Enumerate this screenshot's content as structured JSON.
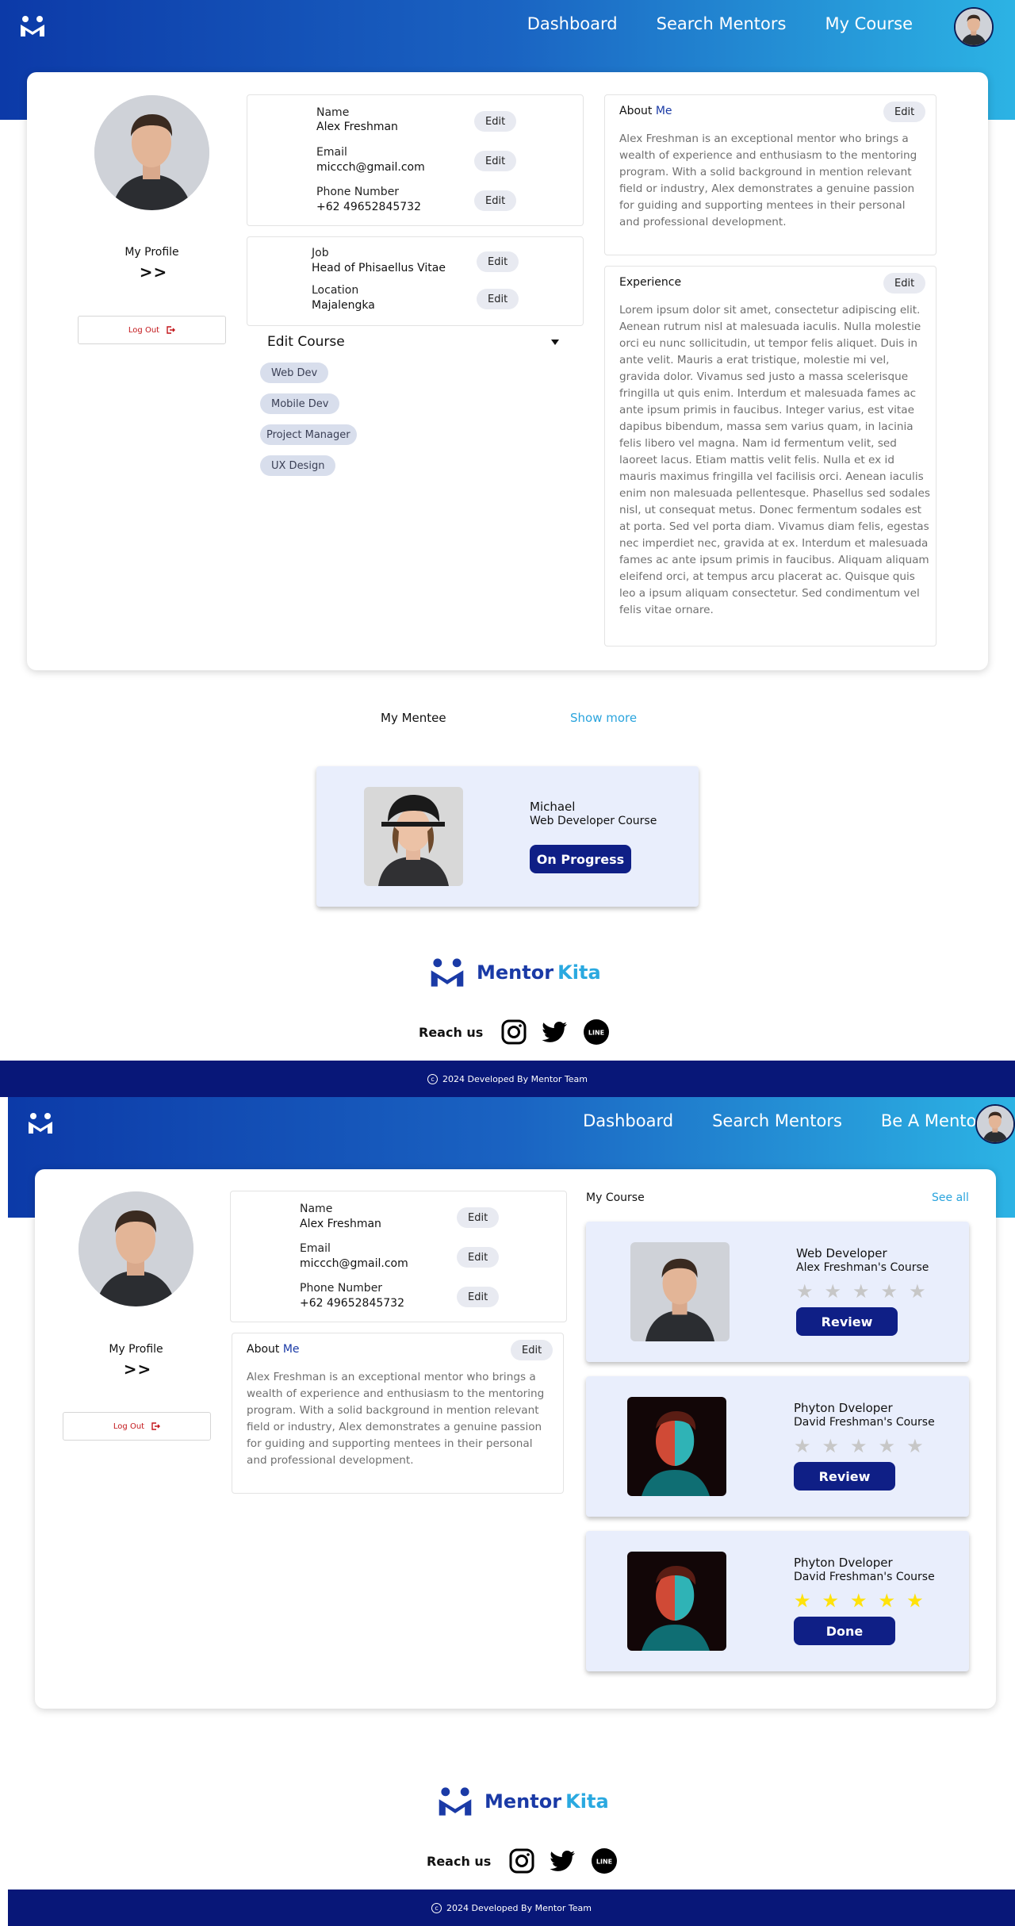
{
  "colors": {
    "primary": "#0f1f86",
    "accent": "#2aa4dd",
    "danger": "#c3171b",
    "star_on": "#ffe20a",
    "star_off": "#c7c7c7"
  },
  "screen1": {
    "nav": {
      "links": [
        "Dashboard",
        "Search Mentors",
        "My Course"
      ]
    },
    "sidebar": {
      "profile_label": "My Profile",
      "chevrons": "> >",
      "logout_label": "Log Out"
    },
    "contact": [
      {
        "label": "Name",
        "value": "Alex Freshman",
        "edit": "Edit"
      },
      {
        "label": "Email",
        "value": "miccch@gmail.com",
        "edit": "Edit"
      },
      {
        "label": "Phone Number",
        "value": "+62 49652845732",
        "edit": "Edit"
      }
    ],
    "work": [
      {
        "label": "Job",
        "value": "Head of Phisaellus Vitae",
        "edit": "Edit"
      },
      {
        "label": "Location",
        "value": "Majalengka",
        "edit": "Edit"
      }
    ],
    "edit_course": {
      "label": "Edit Course",
      "tags": [
        "Web Dev",
        "Mobile Dev",
        "Project Manager",
        "UX Design"
      ]
    },
    "about": {
      "title_prefix": "About ",
      "title_accent": "Me",
      "edit": "Edit",
      "text": "Alex Freshman is an exceptional mentor who brings a wealth of experience  and enthusiasm to the mentoring program. With a solid background in mention relevant field or industry, Alex demonstrates a genuine  passion for guiding and supporting mentees in their personal and  professional development."
    },
    "experience": {
      "title": "Experience",
      "edit": "Edit",
      "text": " Lorem ipsum dolor sit amet, consectetur adipiscing elit. Aenean rutrum  nisl at malesuada iaculis. Nulla molestie orci eu nunc sollicitudin, ut  tempor felis aliquet. Duis in ante velit. Mauris a erat tristique, molestie mi vel, gravida dolor. Vivamus sed justo a massa scelerisque  fringilla ut quis enim. Interdum et malesuada fames ac ante ipsum primis  in faucibus. Integer varius, est vitae dapibus bibendum, massa sem  varius quam, in lacinia felis libero vel magna.  Nam id fermentum velit, sed laoreet lacus. Etiam mattis velit felis.  Nulla et ex id mauris maximus fringilla vel facilisis orci. Aenean  iaculis enim non malesuada pellentesque. Phasellus sed sodales nisl, ut  consequat metus. Donec fermentum sodales est at porta. Sed vel porta  diam. Vivamus diam felis, egestas nec imperdiet nec, gravida at ex.  Interdum et malesuada fames ac ante ipsum primis in faucibus. Aliquam  aliquam eleifend orci, at tempus arcu placerat ac. Quisque quis leo a  ipsum aliquam consectetur. Sed condimentum vel felis vitae ornare."
    },
    "mentee": {
      "title": "My Mentee",
      "show_more": "Show more",
      "card": {
        "name": "Michael",
        "course": "Web Developer Course",
        "status": "On Progress"
      }
    },
    "footer": {
      "brand_1": "Mentor",
      "brand_2": "Kita",
      "reach": "Reach us",
      "copyright_symbol": "c",
      "copyright": "2024 Developed By Mentor Team"
    }
  },
  "screen2": {
    "nav": {
      "links": [
        "Dashboard",
        "Search Mentors",
        "Be A Mentor"
      ]
    },
    "sidebar": {
      "profile_label": "My Profile",
      "chevrons": "> >",
      "logout_label": "Log Out"
    },
    "contact": [
      {
        "label": "Name",
        "value": "Alex Freshman",
        "edit": "Edit"
      },
      {
        "label": "Email",
        "value": "miccch@gmail.com",
        "edit": "Edit"
      },
      {
        "label": "Phone Number",
        "value": "+62 49652845732",
        "edit": "Edit"
      }
    ],
    "about": {
      "title_prefix": "About ",
      "title_accent": "Me",
      "edit": "Edit",
      "text": "Alex Freshman is an exceptional mentor who brings a wealth of experience  and enthusiasm to the mentoring program. With a solid background in mention relevant field or industry, Alex demonstrates a genuine  passion for guiding and supporting mentees in their personal and  professional development."
    },
    "my_course": {
      "title": "My Course",
      "see_all": "See all",
      "items": [
        {
          "title": "Web Developer",
          "subtitle": "Alex Freshman's Course",
          "stars": 0,
          "action": "Review"
        },
        {
          "title": "Phyton Dveloper",
          "subtitle": "David Freshman's Course",
          "stars": 0,
          "action": "Review"
        },
        {
          "title": "Phyton Dveloper",
          "subtitle": "David Freshman's Course",
          "stars": 5,
          "action": "Done"
        }
      ]
    },
    "footer": {
      "brand_1": "Mentor",
      "brand_2": "Kita",
      "reach": "Reach us",
      "copyright_symbol": "c",
      "copyright": "2024 Developed By Mentor Team"
    }
  }
}
